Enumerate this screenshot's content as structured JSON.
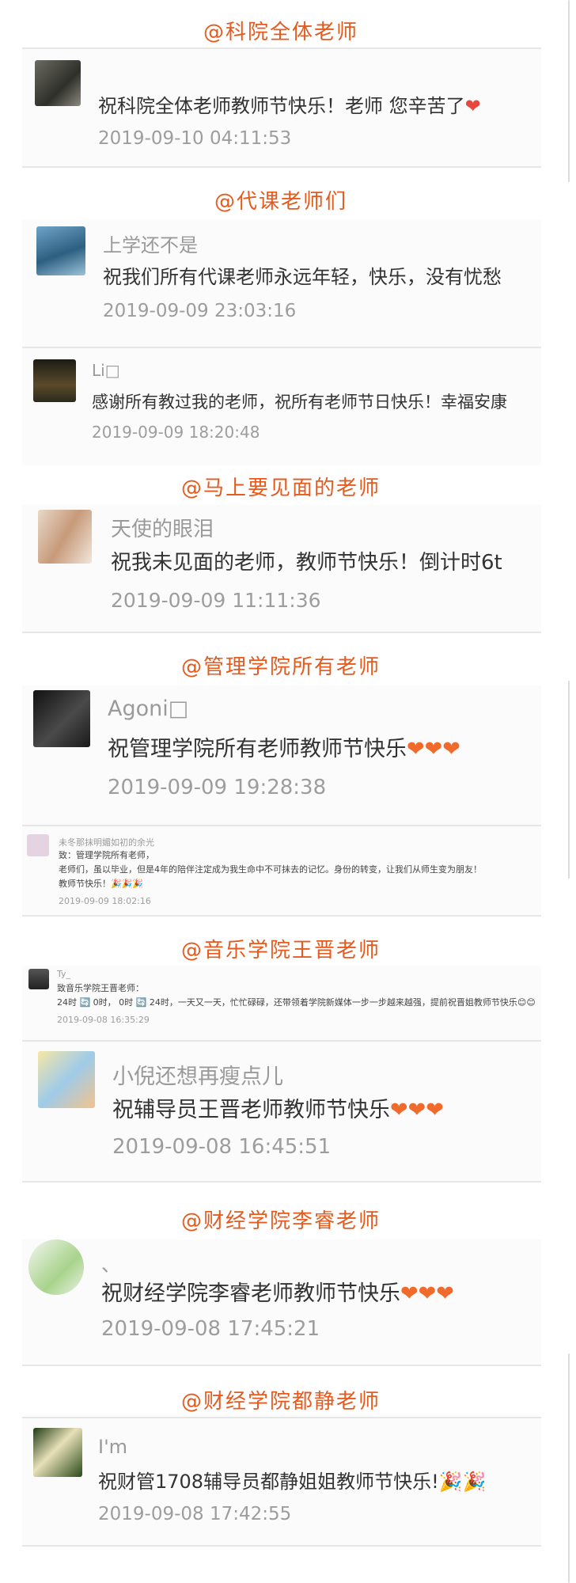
{
  "accent_color": "#e55a1d",
  "sections": [
    {
      "header": "@科院全体老师"
    },
    {
      "header": "@代课老师们"
    },
    {
      "header": "@马上要见面的老师"
    },
    {
      "header": "@管理学院所有老师"
    },
    {
      "header": "@音乐学院王晋老师"
    },
    {
      "header": "@财经学院李睿老师"
    },
    {
      "header": "@财经学院都静老师"
    }
  ],
  "comments": [
    {
      "name": "",
      "message": "祝科院全体老师教师节快乐！老师 您辛苦了",
      "emoji": "❤",
      "time": "2019-09-10 04:11:53"
    },
    {
      "name": "上学还不是",
      "message": "祝我们所有代课老师永远年轻，快乐，没有忧愁",
      "time": "2019-09-09 23:03:16"
    },
    {
      "name": "Li□",
      "message": "感谢所有教过我的老师，祝所有老师节日快乐！幸福安康",
      "time": "2019-09-09 18:20:48"
    },
    {
      "name": "天使的眼泪",
      "message": "祝我未见面的老师，教师节快乐！倒计时6t",
      "time": "2019-09-09 11:11:36"
    },
    {
      "name": "Agoni□",
      "message": "祝管理学院所有老师教师节快乐",
      "emoji": "❤❤❤",
      "time": "2019-09-09 19:28:38"
    },
    {
      "name": "未冬那抹明媚如初的余光",
      "message": "致：管理学院所有老师，\n老师们，虽以毕业，但是4年的陪伴注定成为我生命中不可抹去的记忆。身份的转变，让我们从师生变为朋友！\n教师节快乐！🎉🎉🎉",
      "time": "2019-09-09 18:02:16"
    },
    {
      "name": "Ty_",
      "message": "致音乐学院王晋老师：\n24时 🔄 0时， 0时 🔄 24时，一天又一天，忙忙碌碌，还带领着学院新媒体一步一步越来越强，提前祝晋姐教师节快乐😊😊",
      "time": "2019-09-08 16:35:29"
    },
    {
      "name": "小倪还想再瘦点儿",
      "message": "祝辅导员王晋老师教师节快乐",
      "emoji": "❤❤❤",
      "time": "2019-09-08 16:45:51"
    },
    {
      "name": "、",
      "message": "祝财经学院李睿老师教师节快乐",
      "emoji": "❤❤❤",
      "time": "2019-09-08 17:45:21"
    },
    {
      "name": "I'm",
      "message": "祝财管1708辅导员都静姐姐教师节快乐!",
      "emoji": "🎉🎉",
      "time": "2019-09-08 17:42:55"
    }
  ]
}
